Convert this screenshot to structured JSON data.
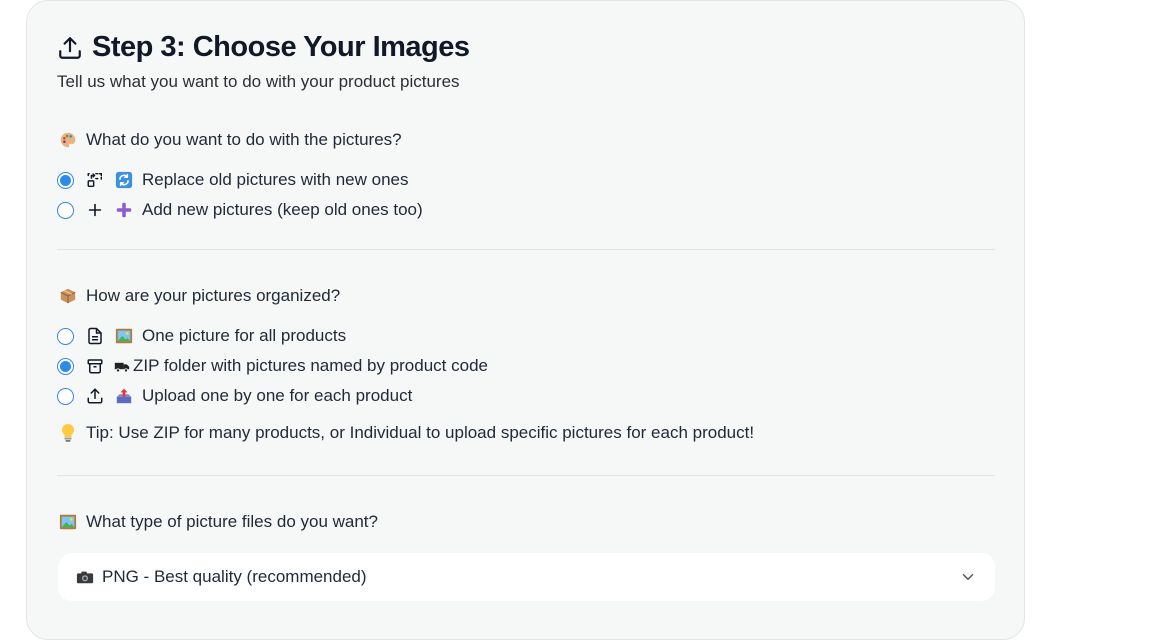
{
  "step": {
    "title": "Step 3: Choose Your Images",
    "subtitle": "Tell us what you want to do with your product pictures",
    "header_icon": "upload-icon"
  },
  "action_question": {
    "label": "What do you want to do with the pictures?",
    "emoji": "palette-icon",
    "options": [
      {
        "label": "Replace old pictures with new ones",
        "selected": true,
        "icon": "replace-icon",
        "emoji": "arrows-cycle-icon"
      },
      {
        "label": "Add new pictures (keep old ones too)",
        "selected": false,
        "icon": "plus-icon",
        "emoji": "plus-emoji-icon"
      }
    ]
  },
  "organization_question": {
    "label": "How are your pictures organized?",
    "emoji": "package-icon",
    "options": [
      {
        "label": "One picture for all products",
        "selected": false,
        "icon": "file-icon",
        "emoji": "framed-picture-icon"
      },
      {
        "label": "ZIP folder with pictures named by product code",
        "selected": true,
        "icon": "archive-icon",
        "emoji": "truck-icon"
      },
      {
        "label": "Upload one by one for each product",
        "selected": false,
        "icon": "upload-icon",
        "emoji": "outbox-tray-icon"
      }
    ],
    "tip": "Tip: Use ZIP for many products, or Individual to upload specific pictures for each product!",
    "tip_emoji": "light-bulb-icon"
  },
  "file_type_question": {
    "label": "What type of picture files do you want?",
    "emoji": "framed-picture-icon",
    "selected_value": "PNG - Best quality (recommended)",
    "selected_emoji": "camera-icon"
  },
  "colors": {
    "accent": "#2b8ce8",
    "card_background": "#f6f7f7",
    "text": "#111827"
  }
}
